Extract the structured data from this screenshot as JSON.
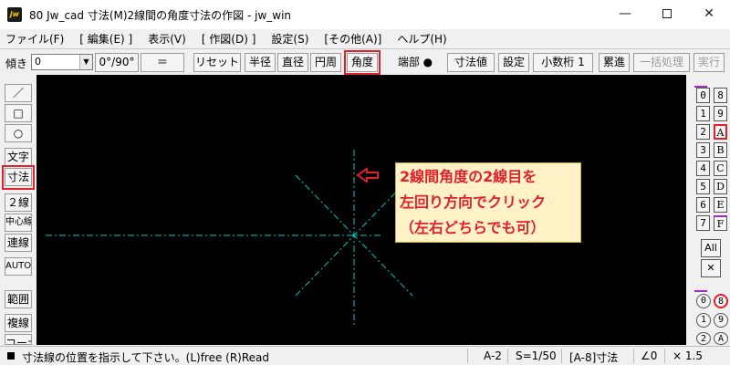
{
  "window": {
    "title": "80 Jw_cad 寸法(M)2線間の角度寸法の作図 - jw_win",
    "app_icon": "jw",
    "controls": [
      "—",
      "☐",
      "✕"
    ]
  },
  "menu": [
    "ファイル(F)",
    "[ 編集(E) ]",
    "表示(V)",
    "[ 作図(D) ]",
    "設定(S)",
    "[その他(A)]",
    "ヘルプ(H)"
  ],
  "toolbar": {
    "slope_label": "傾き",
    "slope_value": "0",
    "angle_toggle": "0°/90°",
    "equal": "＝",
    "reset": "リセット",
    "radius": "半径",
    "diameter": "直径",
    "circumference": "円周",
    "angle": "角度",
    "endpoint_label": "端部 ●",
    "dim_value": "寸法値",
    "settings": "設定",
    "decimal": "小数桁 1",
    "cumulative": "累進",
    "batch": "一括処理",
    "execute": "実行"
  },
  "left_tools": {
    "line": "／",
    "rect": "□",
    "circle": "○",
    "text": "文字",
    "dimension": "寸法",
    "double_line": "２線",
    "center_line": "中心線",
    "connect": "連線",
    "auto": "AUTO",
    "range": "範囲",
    "copy": "複線",
    "corner": "コーナ"
  },
  "right_panel": {
    "left_col": [
      "0",
      "1",
      "2",
      "3",
      "4",
      "5",
      "6",
      "7"
    ],
    "right_col": [
      "8",
      "9",
      "A",
      "B",
      "C",
      "D",
      "E",
      "F"
    ],
    "all": "All",
    "x": "✕",
    "circ_left": [
      "0",
      "1",
      "2"
    ],
    "circ_right": [
      "8",
      "9",
      "A"
    ]
  },
  "callout": {
    "line1": "2線間角度の2線目を",
    "line2": "左回り方向でクリック",
    "line3": "（左右どちらでも可）"
  },
  "status": {
    "message": "寸法線の位置を指示して下さい。(L)free (R)Read",
    "layer_group": "A-2",
    "scale": "S=1/50",
    "layer": "[A-8]寸法",
    "angle": "∠0",
    "zoom": "× 1.5"
  },
  "colors": {
    "canvas_bg": "#000000",
    "construction_line": "#00c8c8",
    "arrow": "#e0202a",
    "highlight": "#e0202a",
    "callout_bg": "#fff2c7",
    "callout_text": "#e0202a",
    "layer_mark": "#9b2fbf"
  }
}
